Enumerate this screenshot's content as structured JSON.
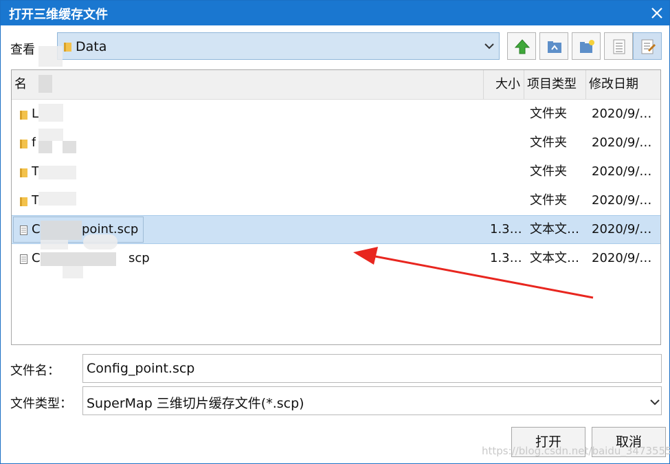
{
  "window": {
    "title": "打开三维缓存文件"
  },
  "lookin": {
    "label": "查看",
    "value": "Data"
  },
  "toolbar": {
    "icons": [
      "up-folder-icon",
      "home-folder-icon",
      "new-folder-icon",
      "list-view-icon",
      "details-view-icon"
    ]
  },
  "columns": {
    "name": "名",
    "size": "大小",
    "type": "项目类型",
    "date": "修改日期"
  },
  "files": [
    {
      "name": "L",
      "size": "",
      "type": "文件夹",
      "date": "2020/9/…",
      "icon": "folder-icon"
    },
    {
      "name": "f",
      "size": "",
      "type": "文件夹",
      "date": "2020/9/…",
      "icon": "folder-icon"
    },
    {
      "name": "T",
      "size": "",
      "type": "文件夹",
      "date": "2020/9/…",
      "icon": "folder-icon"
    },
    {
      "name": "T",
      "size": "",
      "type": "文件夹",
      "date": "2020/9/…",
      "icon": "folder-icon"
    },
    {
      "name": "C",
      "suffix": "point.scp",
      "size": "1.3…",
      "type": "文本文…",
      "date": "2020/9/…",
      "icon": "text-file-icon",
      "selected": true
    },
    {
      "name": "C",
      "suffix": "scp",
      "size": "1.3…",
      "type": "文本文…",
      "date": "2020/9/…",
      "icon": "text-file-icon"
    }
  ],
  "filename": {
    "label": "文件名：",
    "value": "Config_point.scp"
  },
  "filetype": {
    "label": "文件类型：",
    "value": "SuperMap 三维切片缓存文件(*.scp)"
  },
  "buttons": {
    "open": "打开",
    "cancel": "取消"
  },
  "watermark": "https://blog.csdn.net/baidu_34735556",
  "colors": {
    "titlebar": "#1a77d0",
    "selection": "#cce1f5",
    "arrow": "#e8261f"
  }
}
